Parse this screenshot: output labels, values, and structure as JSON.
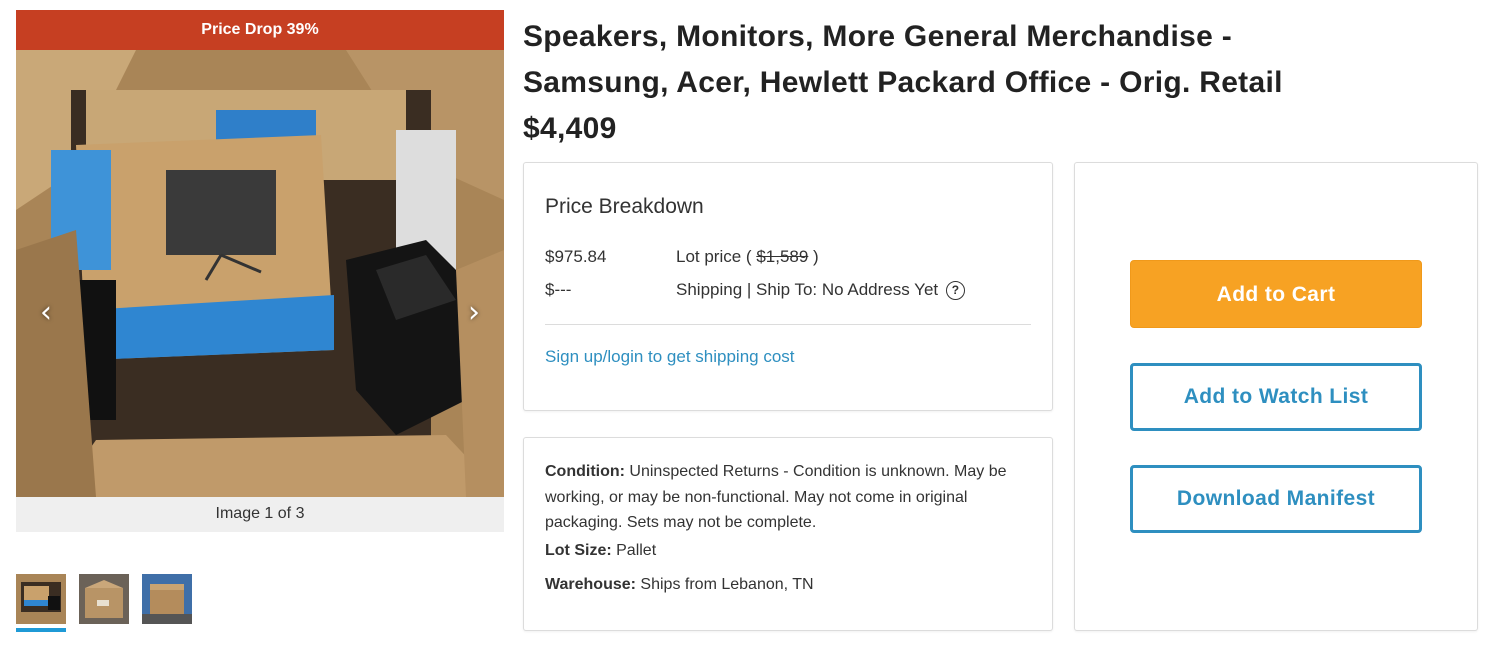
{
  "gallery": {
    "promo_badge": "Price Drop 39%",
    "caption": "Image 1 of 3",
    "prev_icon": "chevron-left-icon",
    "next_icon": "chevron-right-icon",
    "thumbnails": [
      {
        "alt": "thumbnail 1",
        "active": true
      },
      {
        "alt": "thumbnail 2",
        "active": false
      },
      {
        "alt": "thumbnail 3",
        "active": false
      }
    ]
  },
  "product": {
    "title_line1": "Speakers, Monitors, More General Merchandise -",
    "title_line2": "Samsung, Acer, Hewlett Packard Office - Orig. Retail",
    "title_line3": "$4,409"
  },
  "price_breakdown": {
    "heading": "Price Breakdown",
    "lot_amount": "$975.84",
    "lot_label_prefix": "Lot price ( ",
    "lot_original": "$1,589",
    "lot_label_suffix": " )",
    "shipping_amount": "$---",
    "shipping_label": "Shipping | Ship To: No Address Yet",
    "help_symbol": "?",
    "shipping_link": "Sign up/login to get shipping cost"
  },
  "details": {
    "condition_label": "Condition:",
    "condition_value": " Uninspected Returns - Condition is unknown. May be working, or may be non-functional. May not come in original packaging. Sets may not be complete.",
    "lot_size_label": "Lot Size:",
    "lot_size_value": " Pallet",
    "warehouse_label": "Warehouse:",
    "warehouse_value": " Ships from Lebanon, TN"
  },
  "actions": {
    "add_to_cart": "Add to Cart",
    "add_to_watch_list": "Add to Watch List",
    "download_manifest": "Download Manifest"
  },
  "colors": {
    "promo_banner": "#c63f22",
    "cart_button": "#f7a223",
    "link_blue": "#2e8fc0",
    "thumb_active_bar": "#1f9ad6"
  }
}
